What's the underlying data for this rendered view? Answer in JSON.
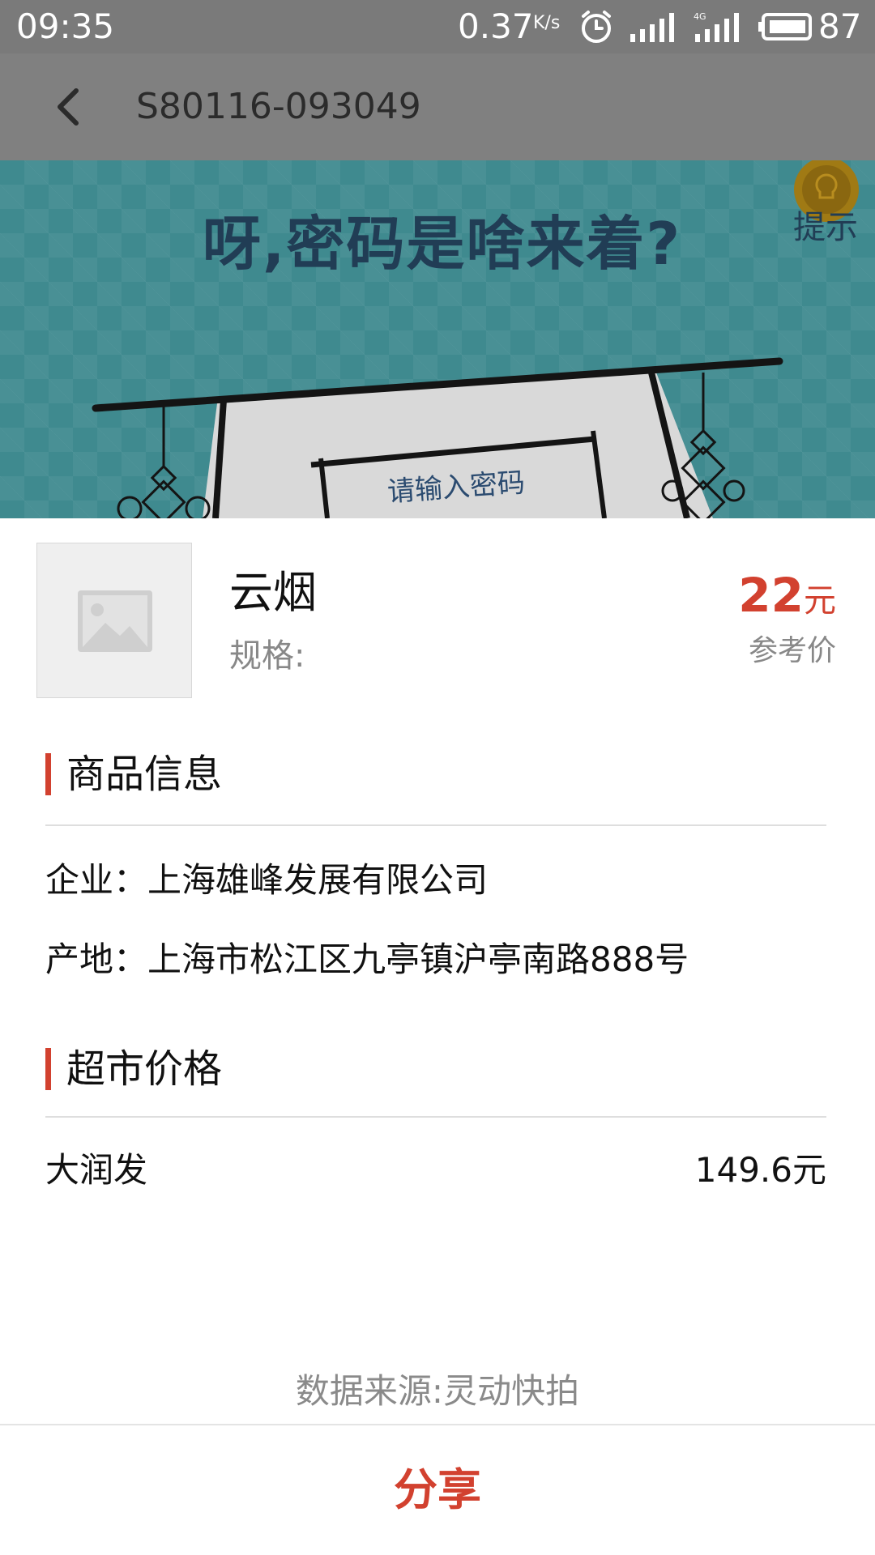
{
  "status_bar": {
    "time": "09:35",
    "net_speed": "0.37",
    "net_speed_unit": "K/s",
    "battery": "87",
    "icons": [
      "alarm-icon",
      "signal-icon",
      "signal-4g-icon",
      "battery-icon"
    ]
  },
  "header": {
    "title": "S80116-093049",
    "back_icon": "chevron-left-icon"
  },
  "banner": {
    "question": "呀,密码是啥来着?",
    "hint_label": "提示",
    "input_placeholder": "请输入密码"
  },
  "product": {
    "name": "云烟",
    "spec_label": "规格:",
    "price_value": "22",
    "price_unit": "元",
    "price_caption": "参考价",
    "image_icon": "image-placeholder-icon"
  },
  "product_info": {
    "title": "商品信息",
    "rows": [
      "企业：上海雄峰发展有限公司",
      "产地：上海市松江区九亭镇沪亭南路888号"
    ]
  },
  "market_prices": {
    "title": "超市价格",
    "rows": [
      {
        "store": "大润发",
        "price": "149.6元"
      }
    ]
  },
  "footer": {
    "data_source": "数据来源:灵动快拍",
    "share_label": "分享"
  },
  "colors": {
    "accent": "#d2412f",
    "overlay_gray": "#7a7a7a",
    "banner_teal": "#3f8a8f"
  }
}
